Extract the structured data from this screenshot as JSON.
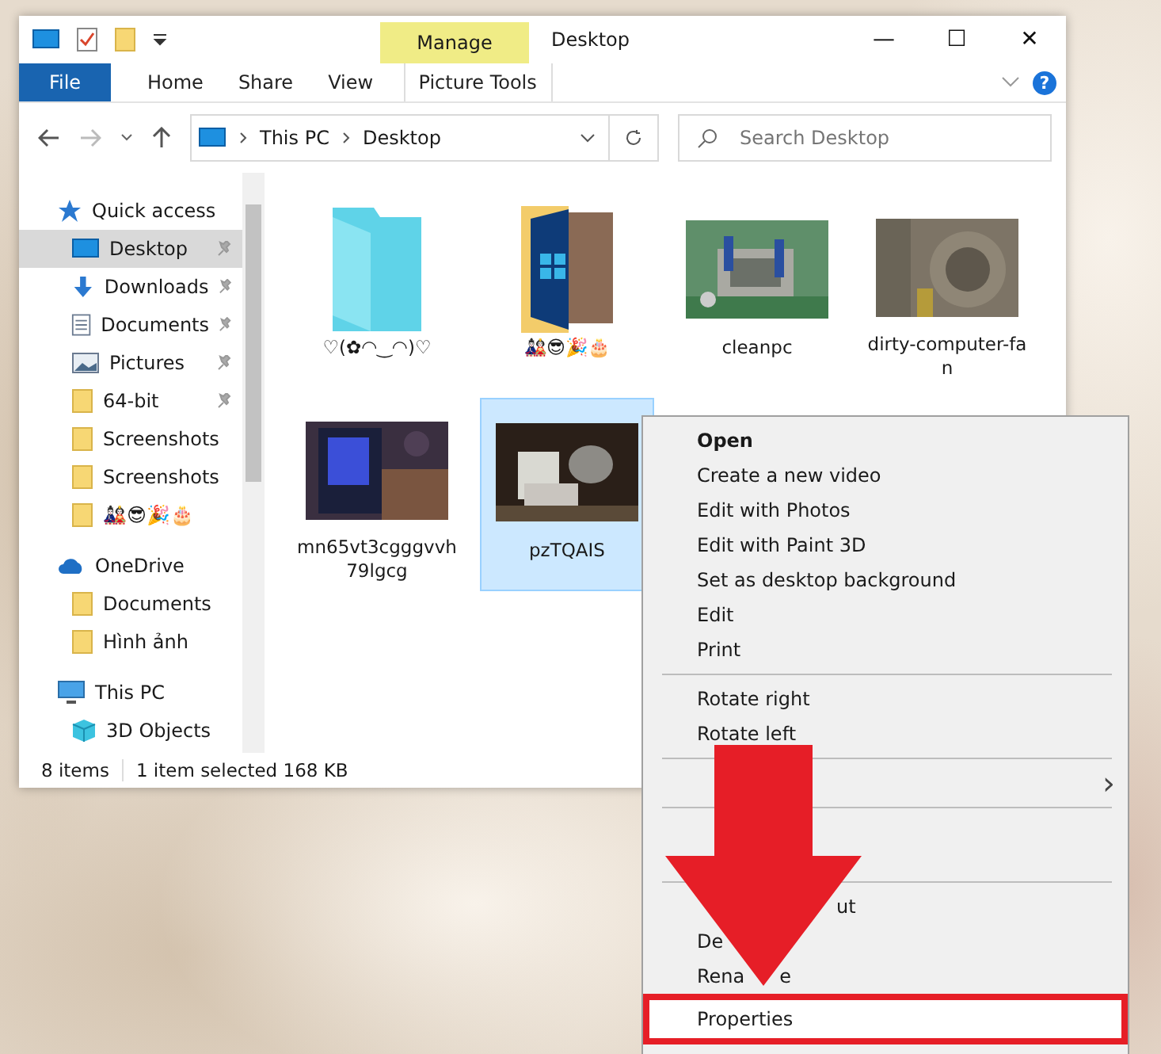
{
  "window": {
    "title": "Desktop",
    "context_tab": "Manage",
    "minimize": "—",
    "maximize": "☐",
    "close": "✕",
    "help": "?"
  },
  "ribbon_tabs": [
    {
      "label": "File",
      "kind": "file"
    },
    {
      "label": "Home",
      "kind": "tab"
    },
    {
      "label": "Share",
      "kind": "tab"
    },
    {
      "label": "View",
      "kind": "tab"
    },
    {
      "label": "Picture Tools",
      "kind": "context"
    }
  ],
  "address": {
    "path": [
      "This PC",
      "Desktop"
    ],
    "search_placeholder": "Search Desktop"
  },
  "sidebar": [
    {
      "label": "Quick access",
      "kind": "star",
      "selected": false,
      "children": [
        {
          "label": "Desktop",
          "kind": "desktop",
          "pinned": true,
          "selected": true
        },
        {
          "label": "Downloads",
          "kind": "download",
          "pinned": true,
          "selected": false
        },
        {
          "label": "Documents",
          "kind": "document",
          "pinned": true,
          "selected": false
        },
        {
          "label": "Pictures",
          "kind": "pictures",
          "pinned": true,
          "selected": false
        },
        {
          "label": "64-bit",
          "kind": "folder",
          "pinned": true,
          "selected": false
        },
        {
          "label": "Screenshots",
          "kind": "folder",
          "pinned": false,
          "selected": false
        },
        {
          "label": "Screenshots",
          "kind": "folder",
          "pinned": false,
          "selected": false
        },
        {
          "label": "🎎😎🎉🎂",
          "kind": "folder",
          "pinned": false,
          "selected": false
        }
      ]
    },
    {
      "label": "OneDrive",
      "kind": "cloud",
      "selected": false,
      "children": [
        {
          "label": "Documents",
          "kind": "folder",
          "pinned": false,
          "selected": false
        },
        {
          "label": "Hình ảnh",
          "kind": "folder",
          "pinned": false,
          "selected": false
        }
      ]
    },
    {
      "label": "This PC",
      "kind": "pc",
      "selected": false,
      "children": [
        {
          "label": "3D Objects",
          "kind": "cube",
          "pinned": false,
          "selected": false
        }
      ]
    }
  ],
  "files": [
    {
      "name": "♡(✿◠‿◠)♡",
      "kind": "folder",
      "selected": false
    },
    {
      "name": "🎎😎🎉🎂",
      "kind": "picture-folder",
      "selected": false
    },
    {
      "name": "cleanpc",
      "selected": false
    },
    {
      "name": "dirty-computer-fan",
      "selected": false
    },
    {
      "name": "mn65vt3cgggvvh79lgcg",
      "selected": false
    },
    {
      "name": "pzTQAIS",
      "selected": true
    }
  ],
  "status_bar": {
    "count": "8 items",
    "selection": "1 item selected  168 KB"
  },
  "context_menu": [
    {
      "kind": "item",
      "text": "Open",
      "bold": true,
      "highlighted": false
    },
    {
      "kind": "item",
      "text": "Create a new video",
      "bold": false,
      "highlighted": false
    },
    {
      "kind": "item",
      "text": "Edit with Photos",
      "bold": false,
      "highlighted": false
    },
    {
      "kind": "item",
      "text": "Edit with Paint 3D",
      "bold": false,
      "highlighted": false
    },
    {
      "kind": "item",
      "text": "Set as desktop background",
      "bold": false,
      "highlighted": false
    },
    {
      "kind": "item",
      "text": "Edit",
      "bold": false,
      "highlighted": false
    },
    {
      "kind": "item",
      "text": "Print",
      "bold": false,
      "highlighted": false
    },
    {
      "kind": "separator"
    },
    {
      "kind": "item",
      "text": "Rotate right",
      "bold": false,
      "highlighted": false
    },
    {
      "kind": "item",
      "text": "Rotate left",
      "bold": false,
      "highlighted": false
    },
    {
      "kind": "separator"
    },
    {
      "kind": "submenu",
      "arrow": "›"
    },
    {
      "kind": "separator"
    },
    {
      "kind": "separator"
    },
    {
      "kind": "tail-only",
      "tail": "ut",
      "highlighted": false
    },
    {
      "kind": "lead-only",
      "text": "De",
      "highlighted": false
    },
    {
      "kind": "split",
      "text": "Rena",
      "tail": "e",
      "highlighted": false
    },
    {
      "kind": "item",
      "text": "Properties",
      "bold": false,
      "highlighted": true
    }
  ]
}
